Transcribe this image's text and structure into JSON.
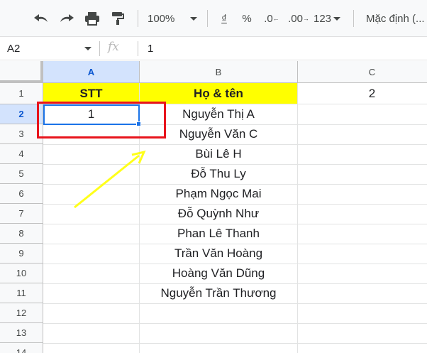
{
  "toolbar": {
    "undo_icon": "undo-icon",
    "redo_icon": "redo-icon",
    "print_icon": "print-icon",
    "paint_format_icon": "paint-format-icon",
    "zoom": "100%",
    "currency": "₫",
    "percent": "%",
    "decrease_decimal": ".0",
    "increase_decimal": ".00",
    "more_formats": "123",
    "font": "Mặc định (..."
  },
  "formula_bar": {
    "cell_ref": "A2",
    "fx_label": "fx",
    "value": "1"
  },
  "columns": [
    "A",
    "B",
    "C"
  ],
  "rows": [
    "1",
    "2",
    "3",
    "4",
    "5",
    "6",
    "7",
    "8",
    "9",
    "10",
    "11",
    "12",
    "13",
    "14"
  ],
  "cells": {
    "A1": "STT",
    "B1": "Họ & tên",
    "C1": "2",
    "A2": "1",
    "names": [
      "Nguyễn Thị A",
      "Nguyễn Văn C",
      "Bùi Lê H",
      "Đỗ Thu Ly",
      "Phạm Ngọc Mai",
      "Đỗ Quỳnh Như",
      "Phan Lê Thanh",
      "Trần Văn Hoàng",
      "Hoàng Văn Dũng",
      "Nguyễn Trần Thương"
    ]
  },
  "colors": {
    "header_fill": "#ffff00",
    "selection": "#1a73e8",
    "annotation_box": "#e8141c",
    "annotation_arrow": "#ffff1a"
  }
}
